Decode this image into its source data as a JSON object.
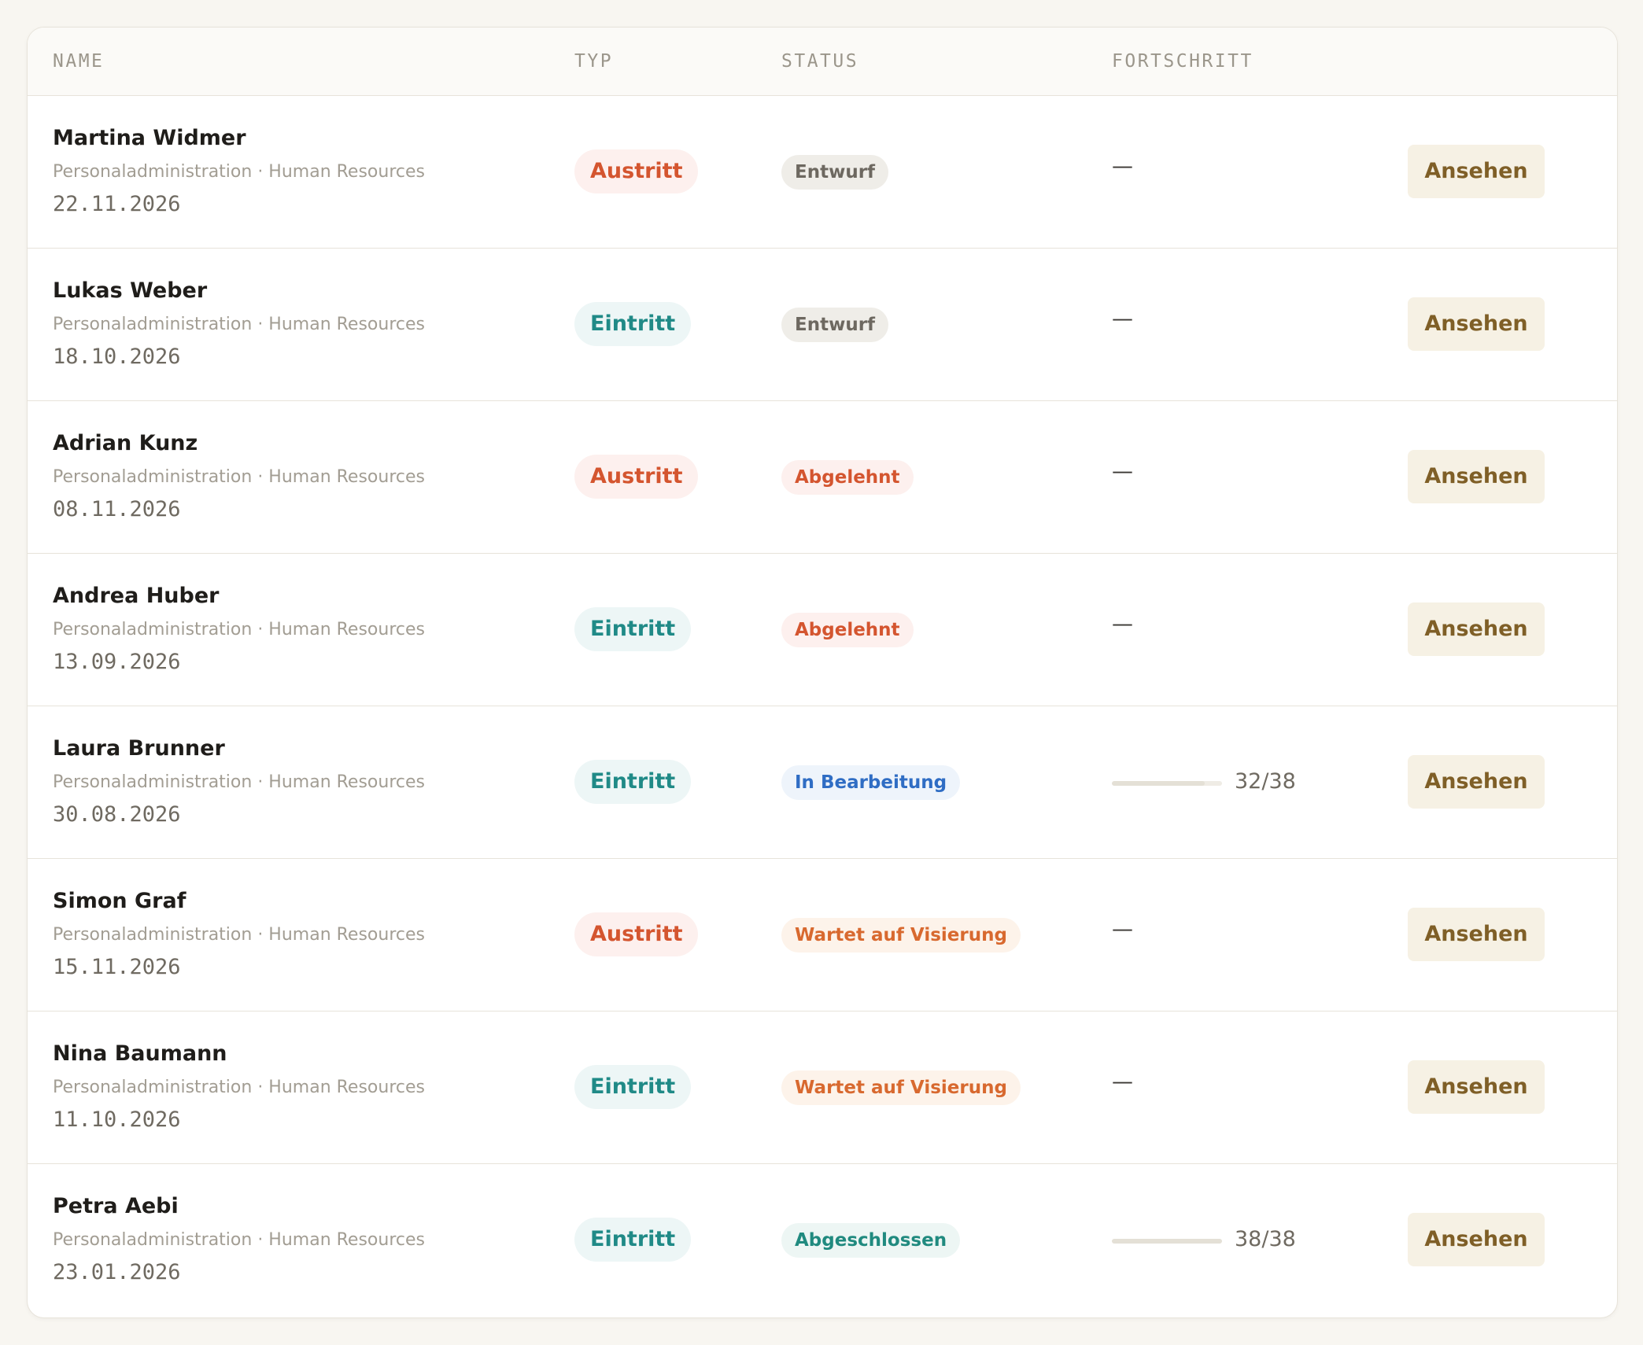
{
  "table": {
    "headers": {
      "name": "NAME",
      "typ": "TYP",
      "status": "STATUS",
      "fortschritt": "FORTSCHRITT"
    },
    "type_styles": {
      "Austritt": {
        "bg": "#fdf0ee",
        "fg": "#d4552f"
      },
      "Eintritt": {
        "bg": "#edf6f6",
        "fg": "#208a87"
      }
    },
    "status_styles": {
      "Entwurf": {
        "bg": "#efede8",
        "fg": "#6d6860"
      },
      "Abgelehnt": {
        "bg": "#fdf0ee",
        "fg": "#d4552f"
      },
      "In Bearbeitung": {
        "bg": "#eef4fb",
        "fg": "#2f6dc4"
      },
      "Wartet auf Visierung": {
        "bg": "#fdf3ea",
        "fg": "#d8692f"
      },
      "Abgeschlossen": {
        "bg": "#edf6f4",
        "fg": "#208a7f"
      }
    },
    "rows": [
      {
        "name": "Martina Widmer",
        "dept": "Personaladministration · Human Resources",
        "date": "22.11.2026",
        "type": "Austritt",
        "status": "Entwurf",
        "progress_text": "—",
        "progress": null,
        "action": "Ansehen"
      },
      {
        "name": "Lukas Weber",
        "dept": "Personaladministration · Human Resources",
        "date": "18.10.2026",
        "type": "Eintritt",
        "status": "Entwurf",
        "progress_text": "—",
        "progress": null,
        "action": "Ansehen"
      },
      {
        "name": "Adrian Kunz",
        "dept": "Personaladministration · Human Resources",
        "date": "08.11.2026",
        "type": "Austritt",
        "status": "Abgelehnt",
        "progress_text": "—",
        "progress": null,
        "action": "Ansehen"
      },
      {
        "name": "Andrea Huber",
        "dept": "Personaladministration · Human Resources",
        "date": "13.09.2026",
        "type": "Eintritt",
        "status": "Abgelehnt",
        "progress_text": "—",
        "progress": null,
        "action": "Ansehen"
      },
      {
        "name": "Laura Brunner",
        "dept": "Personaladministration · Human Resources",
        "date": "30.08.2026",
        "type": "Eintritt",
        "status": "In Bearbeitung",
        "progress_text": "32/38",
        "progress": 0.842,
        "action": "Ansehen"
      },
      {
        "name": "Simon Graf",
        "dept": "Personaladministration · Human Resources",
        "date": "15.11.2026",
        "type": "Austritt",
        "status": "Wartet auf Visierung",
        "progress_text": "—",
        "progress": null,
        "action": "Ansehen"
      },
      {
        "name": "Nina Baumann",
        "dept": "Personaladministration · Human Resources",
        "date": "11.10.2026",
        "type": "Eintritt",
        "status": "Wartet auf Visierung",
        "progress_text": "—",
        "progress": null,
        "action": "Ansehen"
      },
      {
        "name": "Petra Aebi",
        "dept": "Personaladministration · Human Resources",
        "date": "23.01.2026",
        "type": "Eintritt",
        "status": "Abgeschlossen",
        "progress_text": "38/38",
        "progress": 1.0,
        "action": "Ansehen"
      }
    ]
  }
}
